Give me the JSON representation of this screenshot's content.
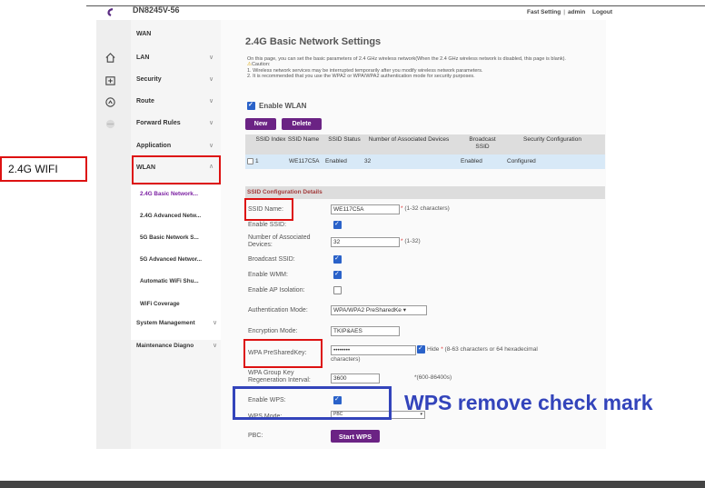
{
  "header": {
    "model": "DN8245V-56",
    "links": [
      "Fast Setting",
      "admin",
      "Logout"
    ]
  },
  "icons": {
    "logo": "we-logo",
    "home": "home-icon",
    "security": "security-box-icon",
    "route": "route-icon",
    "forward": "forward-icon"
  },
  "sidebar": {
    "items": [
      {
        "label": "WAN"
      },
      {
        "label": "LAN"
      },
      {
        "label": "Security"
      },
      {
        "label": "Route"
      },
      {
        "label": "Forward Rules"
      },
      {
        "label": "Application"
      },
      {
        "label": "WLAN"
      },
      {
        "label": "System Management"
      },
      {
        "label": "Maintenance Diagno"
      }
    ],
    "wlan_sub": [
      {
        "label": "2.4G Basic Network..."
      },
      {
        "label": "2.4G Advanced Netw..."
      },
      {
        "label": "5G Basic Network S..."
      },
      {
        "label": "5G Advanced Networ..."
      },
      {
        "label": "Automatic WiFi Shu..."
      },
      {
        "label": "WiFi Coverage"
      }
    ]
  },
  "page": {
    "title": "2.4G Basic Network Settings",
    "desc_line1": "On this page, you can set the basic parameters of 2.4 GHz wireless network(When the 2.4 GHz wireless network is disabled, this page is blank).",
    "caution_label": "Caution:",
    "caution1": "1. Wireless network services may be interrupted temporarily after you modify wireless network parameters.",
    "caution2": "2. It is recommended that you use the WPA2 or WPA/WPA2 authentication mode for security purposes.",
    "enable_wlan": "Enable WLAN",
    "btn_new": "New",
    "btn_delete": "Delete"
  },
  "table": {
    "headers": [
      "SSID Index",
      "SSID Name",
      "SSID Status",
      "Number of Associated Devices",
      "Broadcast SSID",
      "Security Configuration"
    ],
    "row": [
      "1",
      "WE117C5A",
      "Enabled",
      "32",
      "Enabled",
      "Configured"
    ]
  },
  "config": {
    "section_title": "SSID Configuration Details",
    "ssid_name_label": "SSID Name:",
    "ssid_name_value": "WE117C5A",
    "ssid_name_hint": "(1-32 characters)",
    "enable_ssid_label": "Enable SSID:",
    "assoc_label": "Number of Associated Devices:",
    "assoc_value": "32",
    "assoc_hint": "(1-32)",
    "broadcast_label": "Broadcast SSID:",
    "wmm_label": "Enable WMM:",
    "ap_iso_label": "Enable AP Isolation:",
    "auth_label": "Authentication Mode:",
    "auth_value": "WPA/WPA2 PreSharedKe",
    "enc_label": "Encryption Mode:",
    "enc_value": "TKIP&AES",
    "psk_label": "WPA PreSharedKey:",
    "psk_value": "••••••••",
    "hide_label": "Hide",
    "psk_hint": "(8-63 characters or 64 hexadecimal",
    "psk_hint2": "characters)",
    "regroup_label": "WPA Group Key Regeneration Interval:",
    "regroup_value": "3600",
    "regroup_hint": "*(600-86400s)",
    "enable_wps_label": "Enable WPS:",
    "wps_mode_label": "WPS Mode:",
    "wps_mode_value": "PBC",
    "pbc_label": "PBC:",
    "start_wps": "Start WPS"
  },
  "annotations": {
    "wifi_label": "2.4G WIFI",
    "wps_note": "WPS remove check mark"
  },
  "colors": {
    "accent": "#6b2384",
    "red_box": "#dd1111",
    "blue_box": "#3344bb",
    "row_highlight": "#d8e9f7"
  }
}
